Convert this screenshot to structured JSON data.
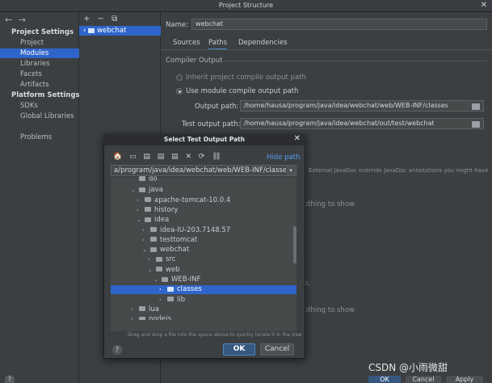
{
  "window": {
    "title": "Project Structure",
    "close": "✕"
  },
  "nav": {
    "arrows": "← →",
    "project_settings": "Project Settings",
    "project_items": [
      "Project",
      "Modules",
      "Libraries",
      "Facets",
      "Artifacts"
    ],
    "platform_settings": "Platform Settings",
    "platform_items": [
      "SDKs",
      "Global Libraries"
    ],
    "problems": "Problems",
    "selected": "Modules"
  },
  "module_tree": {
    "tools": "+ − ⧉",
    "module": "webchat"
  },
  "module": {
    "name_label": "Name:",
    "name_value": "webchat",
    "tabs": [
      "Sources",
      "Paths",
      "Dependencies"
    ],
    "active_tab": "Paths",
    "compiler_output": "Compiler Output",
    "inherit_label": "Inherit project compile output path",
    "use_module_label": "Use module compile output path",
    "output_path_label": "Output path:",
    "output_path_value": "/home/hausa/program/java/idea/webchat/web/WEB-INF/classes",
    "test_output_label": "Test output path:",
    "test_output_value": "/home/hausa/program/java/idea/webchat/out/test/webchat",
    "javadoc_hint": "External JavaDoc override JavaDoc annotations you might have",
    "nothing_to_show_1": "othing to show",
    "period": "e.",
    "nothing_to_show_2": "othing to show"
  },
  "dialog": {
    "title": "Select Test Output Path",
    "close": "✕",
    "tools": "🏠 ▭ ▤ ▤ ▤ ✕ ⟳ ⛓",
    "hide_path": "Hide path",
    "path": "a/program/java/idea/webchat/web/WEB-INF/classes",
    "dropdown": "▾",
    "tree": [
      {
        "indent": 3,
        "arrow": "",
        "label": "go",
        "partial": true
      },
      {
        "indent": 3,
        "arrow": "⌄",
        "label": "java"
      },
      {
        "indent": 4,
        "arrow": "›",
        "label": "apache-tomcat-10.0.4"
      },
      {
        "indent": 4,
        "arrow": "›",
        "label": "history"
      },
      {
        "indent": 4,
        "arrow": "⌄",
        "label": "idea"
      },
      {
        "indent": 5,
        "arrow": "›",
        "label": "idea-IU-203.7148.57"
      },
      {
        "indent": 5,
        "arrow": "›",
        "label": "testtomcat"
      },
      {
        "indent": 5,
        "arrow": "⌄",
        "label": "webchat"
      },
      {
        "indent": 6,
        "arrow": "›",
        "label": "src"
      },
      {
        "indent": 6,
        "arrow": "⌄",
        "label": "web"
      },
      {
        "indent": 7,
        "arrow": "⌄",
        "label": "WEB-INF"
      },
      {
        "indent": 8,
        "arrow": "›",
        "label": "classes",
        "selected": true
      },
      {
        "indent": 8,
        "arrow": "›",
        "label": "lib"
      },
      {
        "indent": 3,
        "arrow": "›",
        "label": "lua"
      },
      {
        "indent": 3,
        "arrow": "›",
        "label": "nodejs",
        "partial": true
      }
    ],
    "drag_hint": "Drag and drop a file into the space above to quickly locate it in the tree",
    "help": "?",
    "ok": "OK",
    "cancel": "Cancel"
  },
  "bottom": {
    "help": "?",
    "ok": "OK",
    "cancel": "Cancel",
    "apply": "Apply"
  },
  "watermark": "CSDN @小雨微甜",
  "colors": {
    "selection": "#2f65ca",
    "link": "#589df6",
    "background": "#3c3f41"
  }
}
